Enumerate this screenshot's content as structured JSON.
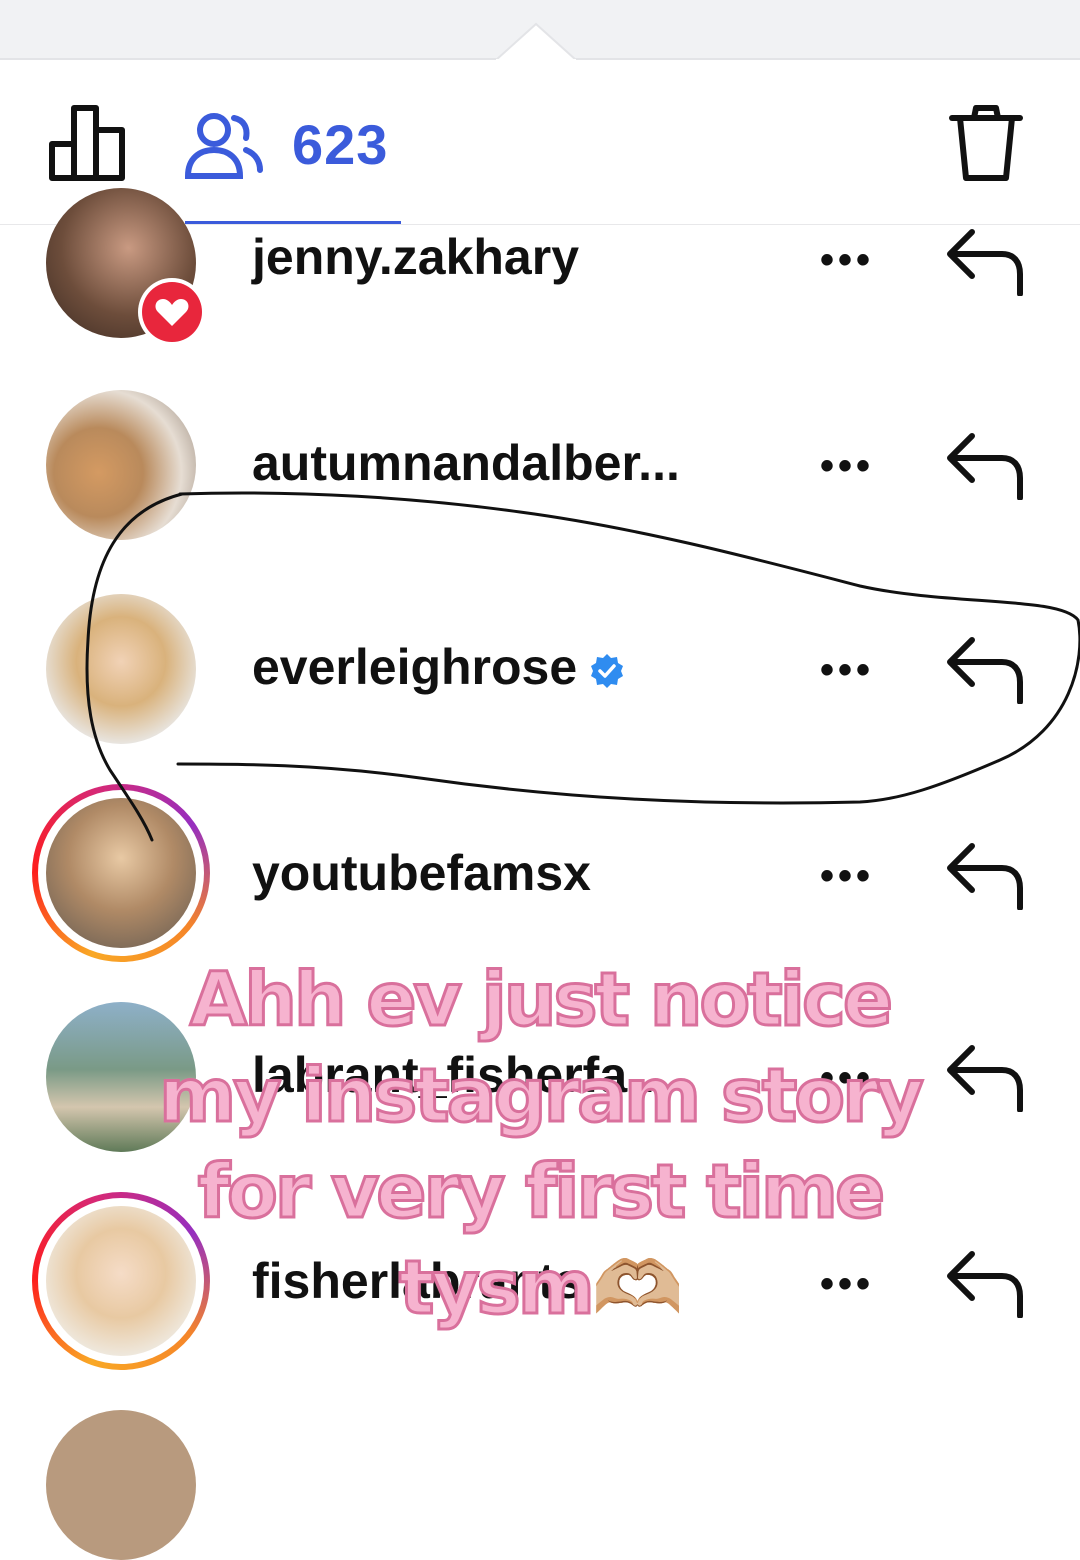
{
  "toolbar": {
    "viewer_count": "623",
    "icons": [
      "bar-chart-icon",
      "viewers-icon",
      "trash-icon"
    ],
    "accent_color": "#3b5bdb"
  },
  "viewers": [
    {
      "username": "jenny.zakhary",
      "liked": true,
      "story_ring": false,
      "verified": false
    },
    {
      "username": "autumnandalber...",
      "liked": false,
      "story_ring": false,
      "verified": false
    },
    {
      "username": "everleighrose",
      "liked": false,
      "story_ring": false,
      "verified": true
    },
    {
      "username": "youtubefamsx",
      "liked": false,
      "story_ring": true,
      "verified": false
    },
    {
      "username": "labrant_fisherfa...",
      "liked": false,
      "story_ring": false,
      "verified": false
    },
    {
      "username": "fisherlabrants",
      "liked": false,
      "story_ring": true,
      "verified": false
    }
  ],
  "row_actions": {
    "more_label": "•••"
  },
  "caption": {
    "line1": "Ahh ev just notice",
    "line2": "my instagram story",
    "line3": "for very first time",
    "line4": "tysm🫶🏼"
  }
}
